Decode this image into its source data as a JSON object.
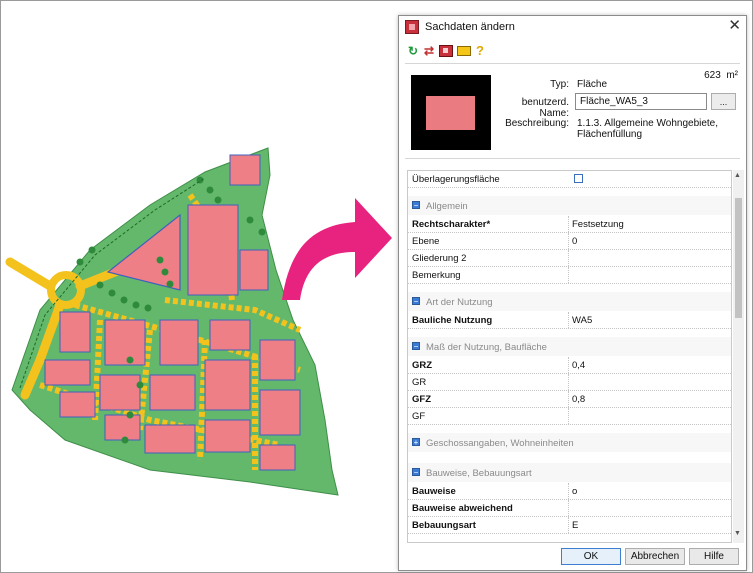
{
  "dialog": {
    "title": "Sachdaten ändern",
    "close_glyph": "✕",
    "app_icon": "sachdaten-app-icon",
    "toolbar": {
      "icons": [
        "refresh-icon",
        "swap-arrows-icon",
        "grid-table-icon",
        "rectangle-icon",
        "help-icon"
      ],
      "area_value": "623",
      "area_unit": "m²"
    },
    "preview": {
      "fill_color": "#ea7b80",
      "background": "#000000"
    },
    "header": {
      "typ_label": "Typ:",
      "typ_value": "Fläche",
      "name_label": "benutzerd. Name:",
      "name_value": "Fläche_WA5_3",
      "more_button": "...",
      "beschreibung_label": "Beschreibung:",
      "beschreibung_line1": "1.1.3. Allgemeine Wohngebiete,",
      "beschreibung_line2": "Flächenfüllung"
    },
    "properties": {
      "ueberlagerung": {
        "label": "Überlagerungsfläche",
        "checked": false
      },
      "allgemein": {
        "title": "Allgemein",
        "rows": [
          {
            "key": "Rechtscharakter*",
            "value": "Festsetzung"
          },
          {
            "key": "Ebene",
            "value": "0"
          },
          {
            "key": "Gliederung 2",
            "value": ""
          },
          {
            "key": "Bemerkung",
            "value": ""
          }
        ]
      },
      "art": {
        "title": "Art der Nutzung",
        "rows": [
          {
            "key": "Bauliche Nutzung",
            "value": "WA5"
          }
        ]
      },
      "mass": {
        "title": "Maß der Nutzung, Baufläche",
        "rows": [
          {
            "key": "GRZ",
            "value": "0,4"
          },
          {
            "key": "GR",
            "value": ""
          },
          {
            "key": "GFZ",
            "value": "0,8"
          },
          {
            "key": "GF",
            "value": ""
          }
        ]
      },
      "geschoss": {
        "title": "Geschossangaben, Wohneinheiten"
      },
      "bauweise": {
        "title": "Bauweise, Bebauungsart",
        "rows": [
          {
            "key": "Bauweise",
            "value": "o"
          },
          {
            "key": "Bauweise abweichend",
            "value": ""
          },
          {
            "key": "Bebauungsart",
            "value": "E"
          }
        ]
      }
    },
    "buttons": {
      "ok": "OK",
      "cancel": "Abbrechen",
      "help": "Hilfe"
    }
  },
  "colors": {
    "plan_green": "#63b86b",
    "plan_green_dark": "#2f8a3c",
    "building_pink": "#ee7f86",
    "building_outline": "#4060c0",
    "road_yellow": "#f3c21d",
    "arrow_magenta": "#e8237f"
  }
}
